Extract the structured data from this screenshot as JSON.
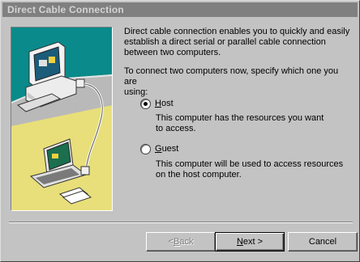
{
  "window": {
    "title": "Direct Cable Connection"
  },
  "intro": {
    "line1": "Direct cable connection enables you to quickly and easily",
    "line2": "establish a direct serial or parallel cable connection",
    "line3": "between two computers."
  },
  "prompt": {
    "line1": "To connect two computers now, specify which one you are",
    "line2": "using:"
  },
  "options": [
    {
      "hotkey": "H",
      "rest": "ost",
      "selected": true,
      "desc1": "This computer has the resources you want",
      "desc2": "to access."
    },
    {
      "hotkey": "G",
      "rest": "uest",
      "selected": false,
      "desc1": "This computer will be used to access resources",
      "desc2": "on the host computer."
    }
  ],
  "buttons": {
    "back": {
      "pre": "< ",
      "hotkey": "B",
      "rest": "ack"
    },
    "next": {
      "hotkey": "N",
      "rest": "ext >"
    },
    "cancel": "Cancel"
  },
  "colors": {
    "dialog": "#c3c3c3",
    "titlebar_inactive": "#808080",
    "illustration_teal": "#0a8a8a",
    "illustration_desk": "#e8df7a"
  },
  "icons": {
    "illustration": "desktop-computer-and-laptop-with-cable"
  }
}
